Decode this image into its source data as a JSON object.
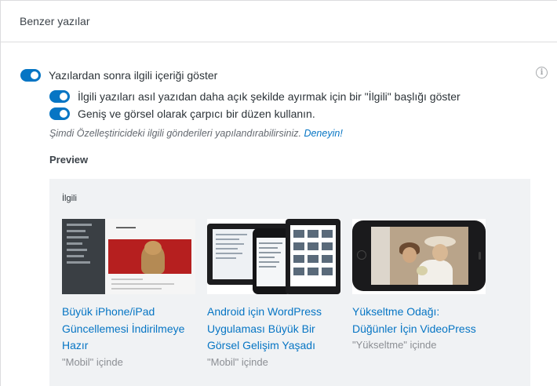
{
  "section": {
    "title": "Benzer yazılar"
  },
  "settings": {
    "show_related": {
      "label": "Yazılardan sonra ilgili içeriği göster",
      "enabled": true
    },
    "show_headline": {
      "label": "İlgili yazıları asıl yazıdan daha açık şekilde ayırmak için bir \"İlgili\" başlığı göster",
      "enabled": true
    },
    "show_thumbnails": {
      "label": "Geniş ve görsel olarak çarpıcı bir düzen kullanın.",
      "enabled": true
    },
    "hint": {
      "text": "Şimdi Özelleştiricideki ilgili gönderileri yapılandırabilirsiniz.",
      "link": "Deneyin!"
    }
  },
  "preview": {
    "title": "Preview",
    "heading": "İlgili",
    "posts": [
      {
        "title": "Büyük iPhone/iPad Güncellemesi İndirilmeye Hazır",
        "category": "\"Mobil\" içinde",
        "thumbnail": "blog-screenshot-with-cat"
      },
      {
        "title": "Android için WordPress Uygulaması Büyük Bir Görsel Gelişim Yaşadı",
        "category": "\"Mobil\" içinde",
        "thumbnail": "tablets-and-phone-devices"
      },
      {
        "title": "Yükseltme Odağı: Düğünler İçin VideoPress",
        "category": "\"Yükseltme\" içinde",
        "thumbnail": "iphone-wedding-video"
      }
    ]
  },
  "icons": {
    "info": "info-icon"
  },
  "colors": {
    "accent": "#0675c4",
    "muted": "#8c8f94",
    "preview_bg": "#f0f2f4"
  }
}
